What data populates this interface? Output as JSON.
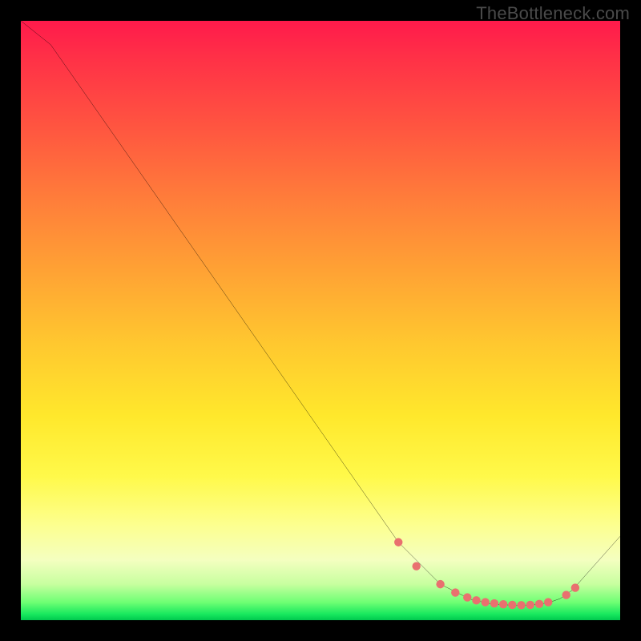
{
  "watermark": "TheBottleneck.com",
  "chart_data": {
    "type": "line",
    "title": "",
    "xlabel": "",
    "ylabel": "",
    "xlim": [
      0,
      100
    ],
    "ylim": [
      0,
      100
    ],
    "series": [
      {
        "name": "curve",
        "x": [
          0,
          5,
          63,
          70,
          75,
          78,
          80,
          82,
          84,
          86,
          88,
          90,
          92,
          100
        ],
        "y": [
          100,
          96,
          13,
          6,
          3.5,
          2.8,
          2.6,
          2.5,
          2.5,
          2.6,
          2.9,
          3.6,
          5,
          14
        ],
        "color": "#000000"
      }
    ],
    "markers": {
      "name": "highlight-dots",
      "color": "#e9706f",
      "radius": 5.2,
      "points": [
        {
          "x": 63,
          "y": 13
        },
        {
          "x": 66,
          "y": 9
        },
        {
          "x": 70,
          "y": 6
        },
        {
          "x": 72.5,
          "y": 4.6
        },
        {
          "x": 74.5,
          "y": 3.8
        },
        {
          "x": 76,
          "y": 3.3
        },
        {
          "x": 77.5,
          "y": 3.0
        },
        {
          "x": 79,
          "y": 2.8
        },
        {
          "x": 80.5,
          "y": 2.65
        },
        {
          "x": 82,
          "y": 2.55
        },
        {
          "x": 83.5,
          "y": 2.5
        },
        {
          "x": 85,
          "y": 2.55
        },
        {
          "x": 86.5,
          "y": 2.7
        },
        {
          "x": 88,
          "y": 3.0
        },
        {
          "x": 91,
          "y": 4.2
        },
        {
          "x": 92.5,
          "y": 5.4
        }
      ]
    },
    "background_gradient": {
      "direction": "vertical",
      "stops": [
        {
          "pos": 0.0,
          "color": "#ff1a4b"
        },
        {
          "pos": 0.3,
          "color": "#ff7e3a"
        },
        {
          "pos": 0.66,
          "color": "#ffe82c"
        },
        {
          "pos": 0.9,
          "color": "#f4ffc0"
        },
        {
          "pos": 1.0,
          "color": "#00c94e"
        }
      ]
    }
  }
}
